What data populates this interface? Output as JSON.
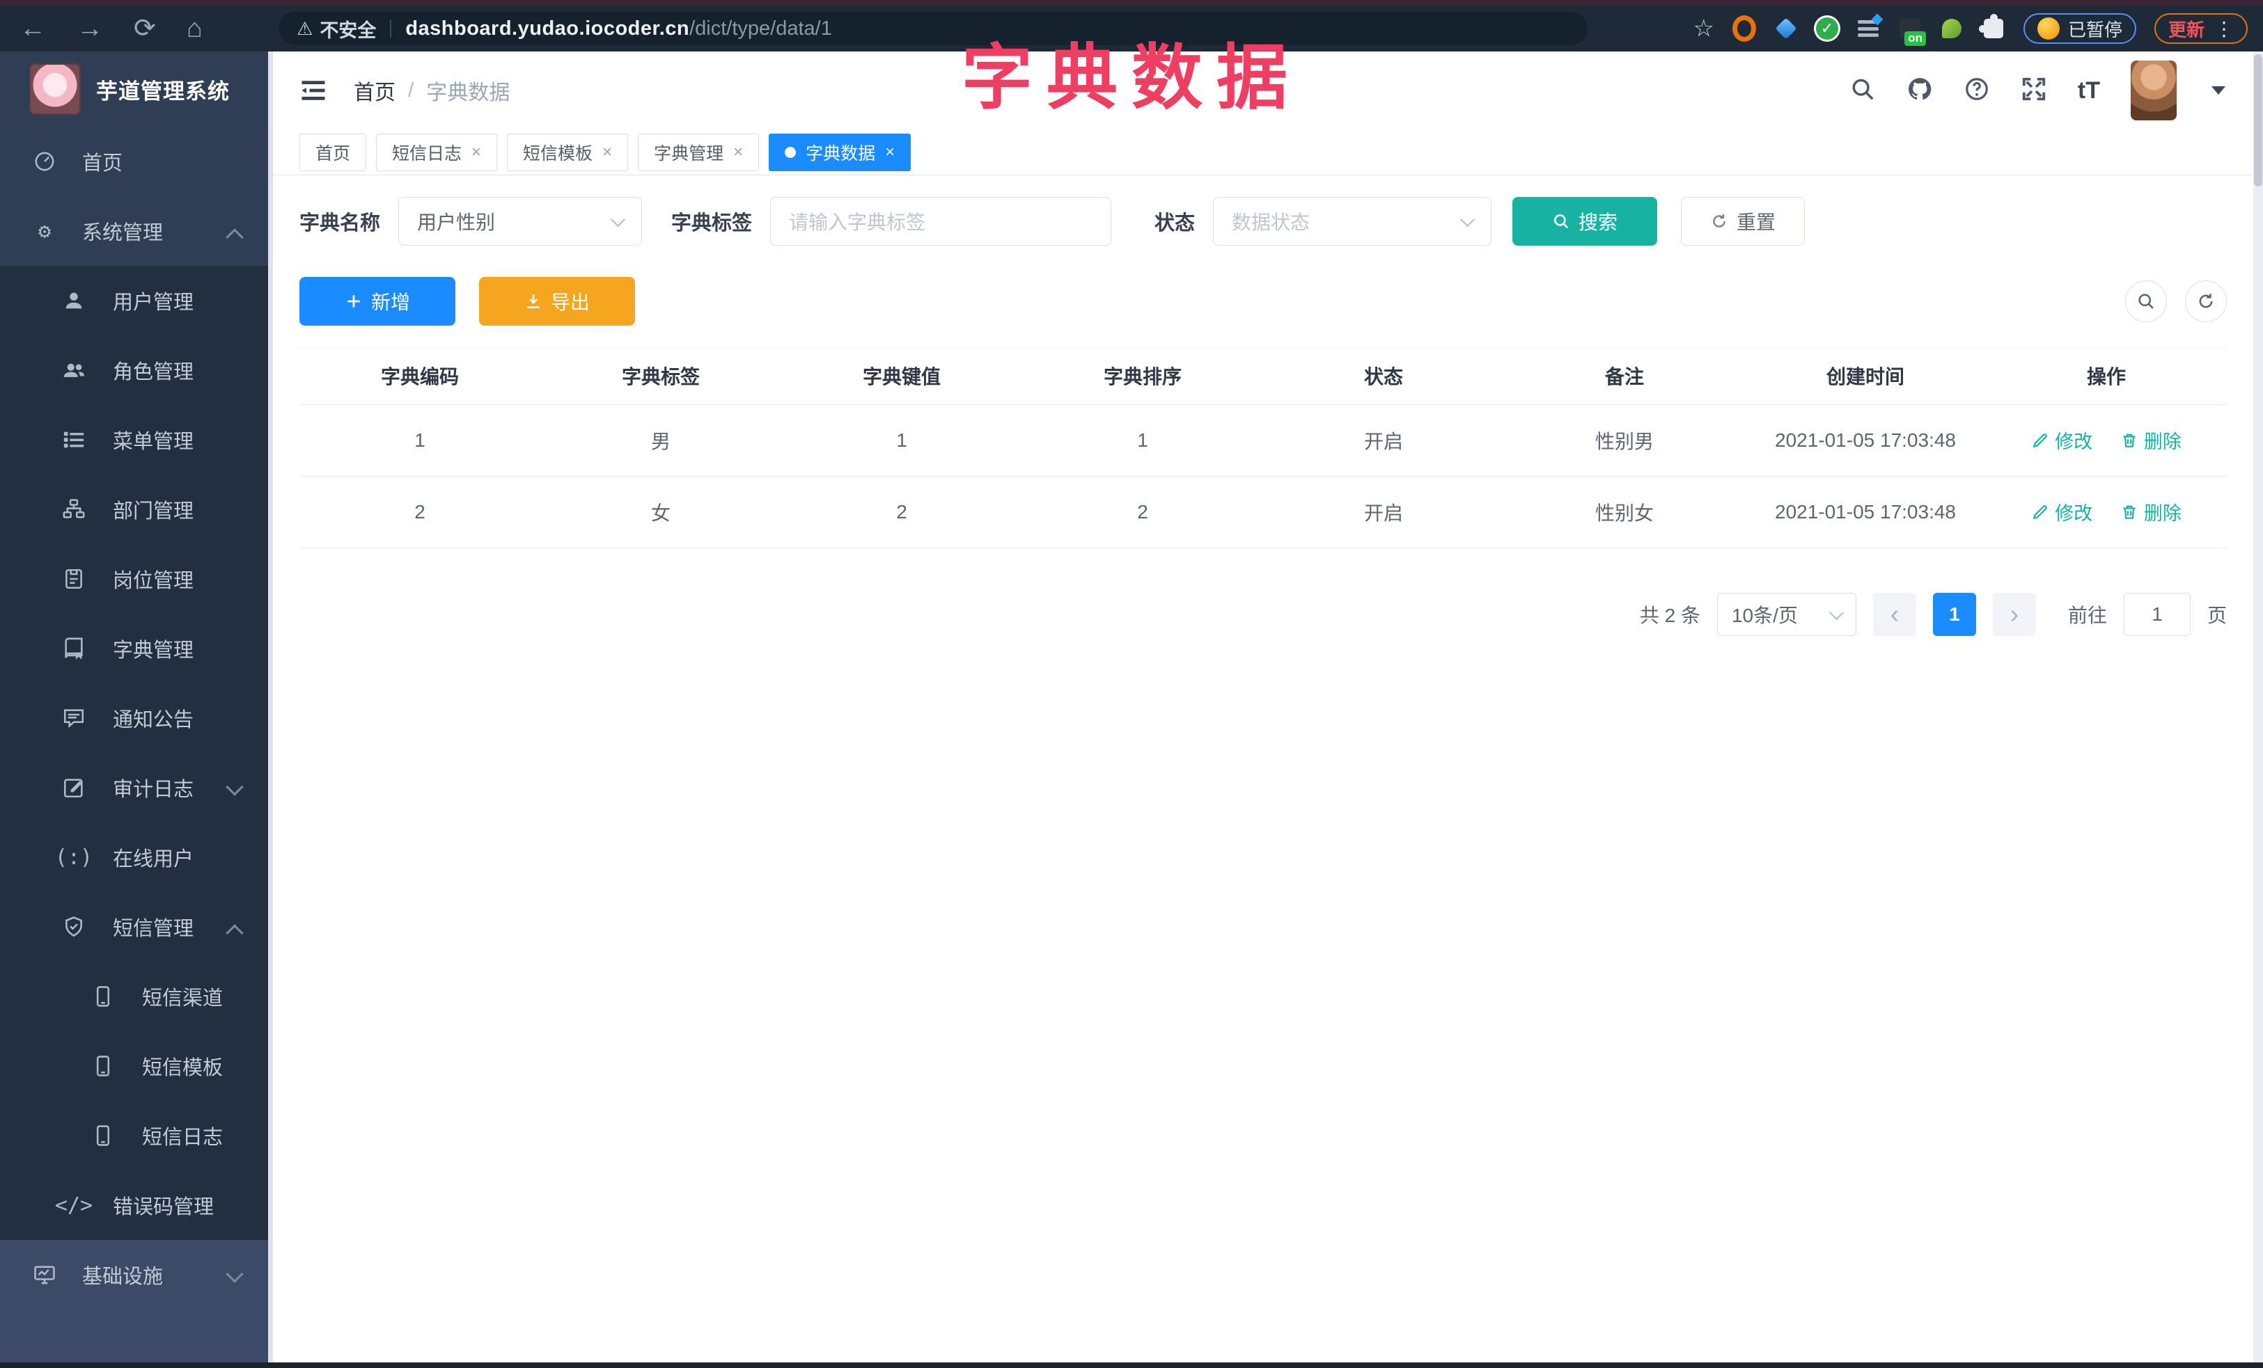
{
  "chrome": {
    "security": "不安全",
    "url_host": "dashboard.yudao.iocoder.cn",
    "url_path": "/dict/type/data/1",
    "on_badge": "on",
    "paused_label": "已暂停",
    "update_label": "更新"
  },
  "overlay_title": "字典数据",
  "sidebar": {
    "logo_title": "芋道管理系统",
    "items": [
      {
        "label": "首页"
      },
      {
        "label": "系统管理"
      },
      {
        "label": "用户管理"
      },
      {
        "label": "角色管理"
      },
      {
        "label": "菜单管理"
      },
      {
        "label": "部门管理"
      },
      {
        "label": "岗位管理"
      },
      {
        "label": "字典管理"
      },
      {
        "label": "通知公告"
      },
      {
        "label": "审计日志"
      },
      {
        "label": "在线用户"
      },
      {
        "label": "短信管理"
      },
      {
        "label": "短信渠道"
      },
      {
        "label": "短信模板"
      },
      {
        "label": "短信日志"
      },
      {
        "label": "错误码管理"
      },
      {
        "label": "基础设施"
      }
    ]
  },
  "header": {
    "breadcrumb_home": "首页",
    "breadcrumb_sep": "/",
    "breadcrumb_current": "字典数据",
    "font_icon_label": "tT"
  },
  "tabs": {
    "close_glyph": "×",
    "items": [
      {
        "label": "首页"
      },
      {
        "label": "短信日志"
      },
      {
        "label": "短信模板"
      },
      {
        "label": "字典管理"
      },
      {
        "label": "字典数据"
      }
    ]
  },
  "filter": {
    "dict_name_label": "字典名称",
    "dict_name_value": "用户性别",
    "dict_label_label": "字典标签",
    "dict_label_placeholder": "请输入字典标签",
    "status_label": "状态",
    "status_placeholder": "数据状态",
    "search_label": "搜索",
    "reset_label": "重置"
  },
  "toolbar": {
    "add_label": "新增",
    "export_label": "导出"
  },
  "table": {
    "headers": [
      "字典编码",
      "字典标签",
      "字典键值",
      "字典排序",
      "状态",
      "备注",
      "创建时间",
      "操作"
    ],
    "rows": [
      {
        "code": "1",
        "label": "男",
        "value": "1",
        "sort": "1",
        "status": "开启",
        "remark": "性别男",
        "created": "2021-01-05 17:03:48"
      },
      {
        "code": "2",
        "label": "女",
        "value": "2",
        "sort": "2",
        "status": "开启",
        "remark": "性别女",
        "created": "2021-01-05 17:03:48"
      }
    ],
    "edit_label": "修改",
    "delete_label": "删除"
  },
  "pagination": {
    "total": "共 2 条",
    "page_size": "10条/页",
    "page": "1",
    "goto_label": "前往",
    "goto_value": "1",
    "unit": "页"
  },
  "colors": {
    "accent_blue": "#1a8cff",
    "teal": "#16b3a3",
    "export_orange": "#f6a51f",
    "title_pink": "#ee3f62",
    "sidebar_bg": "#2f3e53",
    "submenu_bg": "#222f40"
  }
}
